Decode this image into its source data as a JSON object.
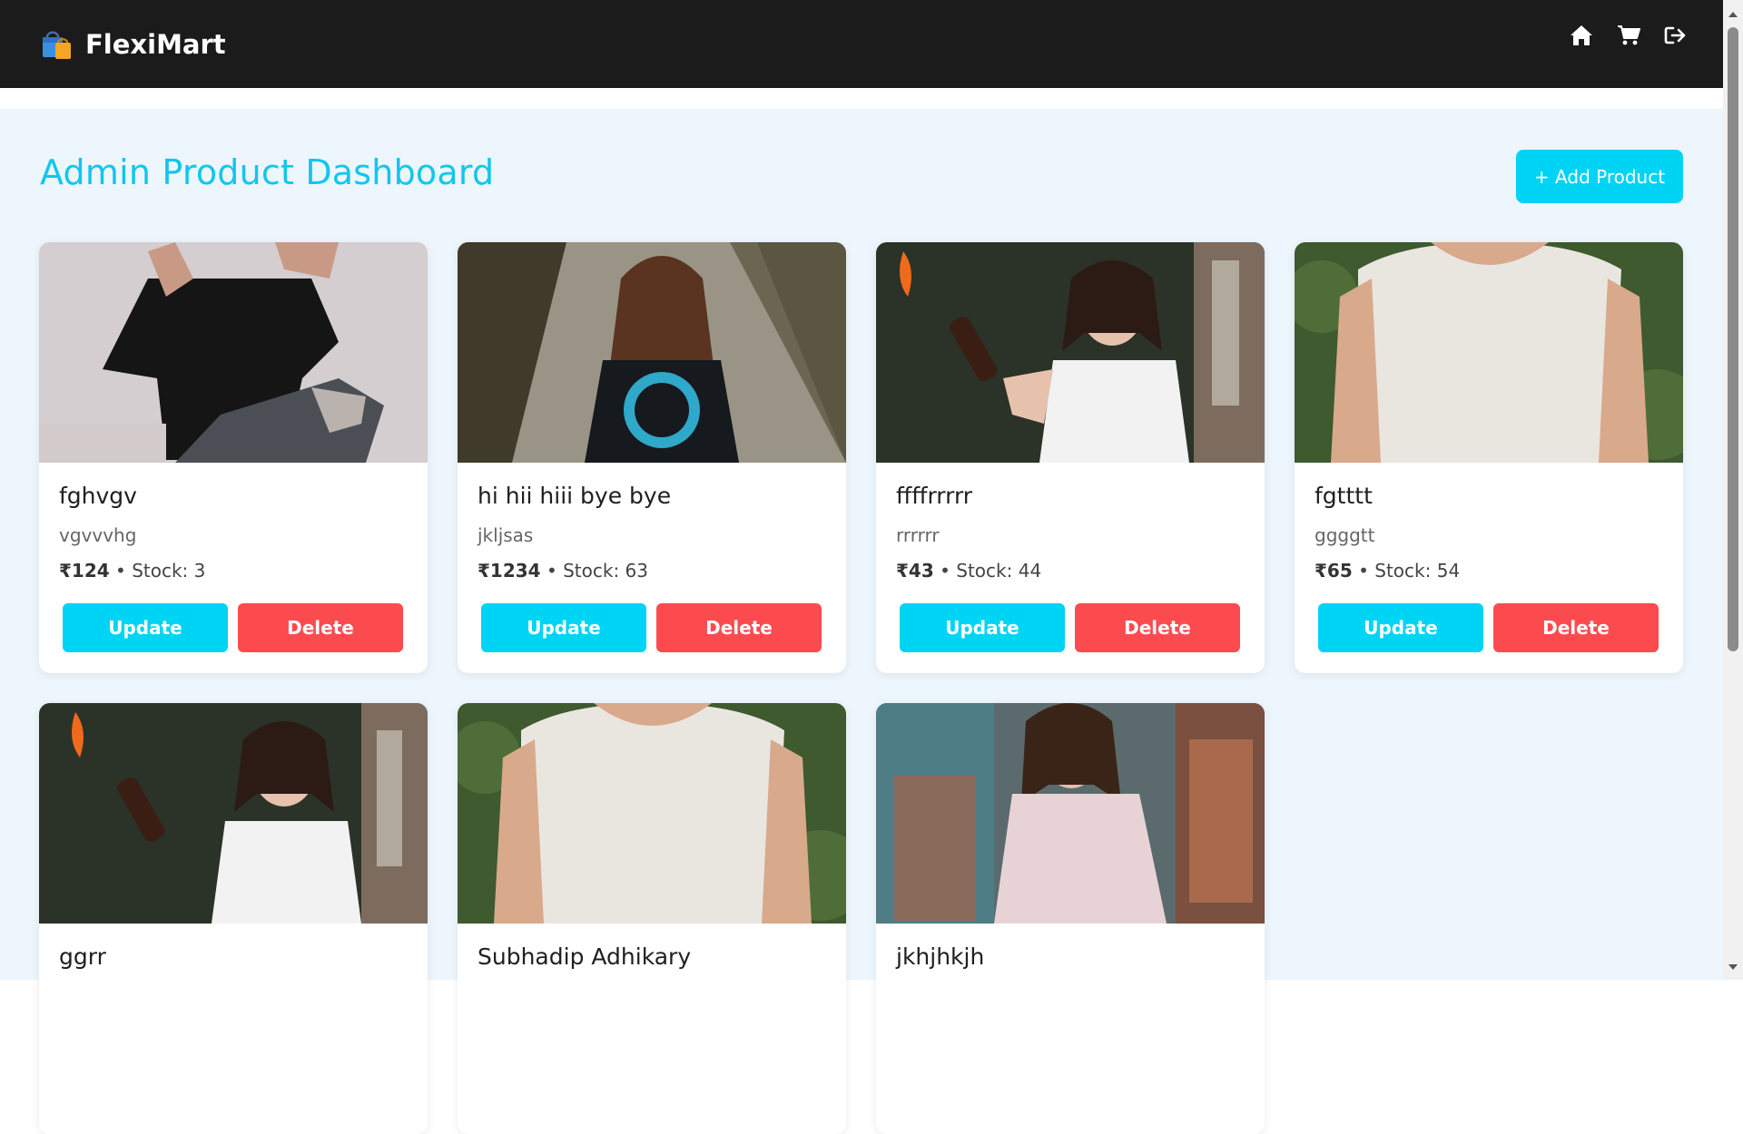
{
  "app": {
    "name": "FlexiMart"
  },
  "nav": {
    "icons": [
      "home-icon",
      "cart-icon",
      "logout-icon"
    ]
  },
  "page": {
    "title": "Admin Product Dashboard",
    "add_button": "+ Add Product"
  },
  "colors": {
    "accent": "#00d4f5",
    "danger": "#fc4b4f",
    "navbar": "#1b1b1b",
    "background": "#eef6fd"
  },
  "products": [
    {
      "name": "fghvgv",
      "description": "vgvvvhg",
      "price": "₹124",
      "stock": "Stock: 3",
      "update_label": "Update",
      "delete_label": "Delete"
    },
    {
      "name": "hi hii hiii bye bye",
      "description": "jkljsas",
      "price": "₹1234",
      "stock": "Stock: 63",
      "update_label": "Update",
      "delete_label": "Delete"
    },
    {
      "name": "ffffrrrrr",
      "description": "rrrrrr",
      "price": "₹43",
      "stock": "Stock: 44",
      "update_label": "Update",
      "delete_label": "Delete"
    },
    {
      "name": "fgtttt",
      "description": "ggggtt",
      "price": "₹65",
      "stock": "Stock: 54",
      "update_label": "Update",
      "delete_label": "Delete"
    },
    {
      "name": "ggrr"
    },
    {
      "name": "Subhadip Adhikary"
    },
    {
      "name": "jkhjhkjh"
    }
  ]
}
